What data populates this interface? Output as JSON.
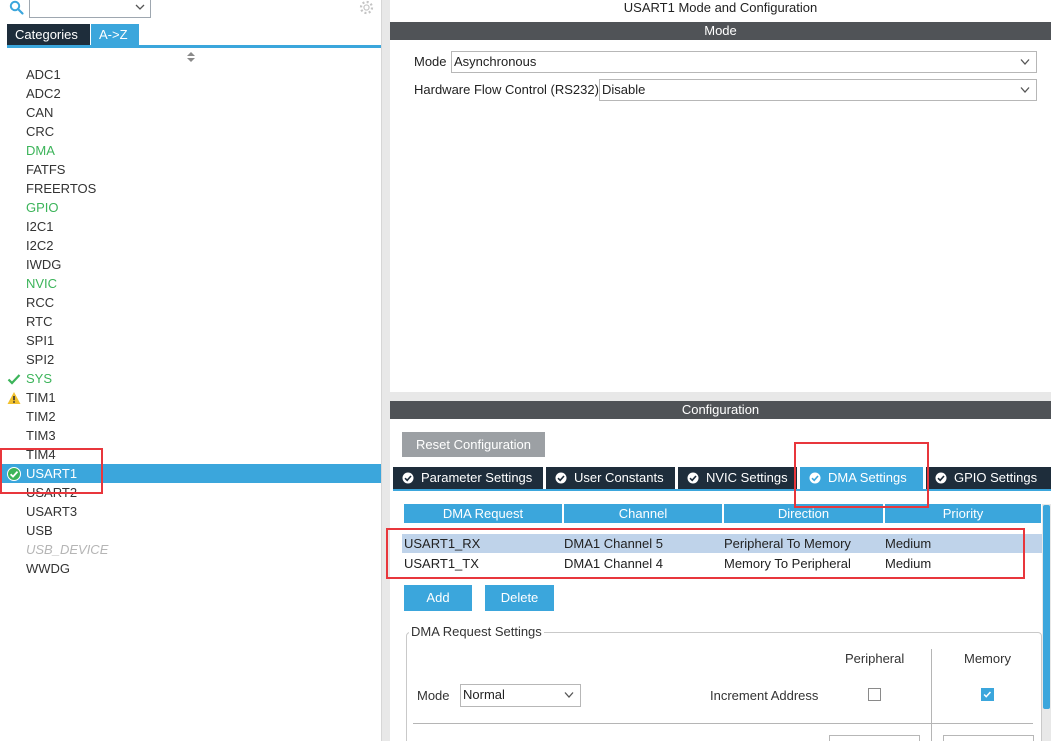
{
  "left_panel": {
    "search_value": "",
    "tabs": [
      "Categories",
      "A->Z"
    ],
    "peripherals": [
      {
        "label": "ADC1",
        "state": "normal"
      },
      {
        "label": "ADC2",
        "state": "normal"
      },
      {
        "label": "CAN",
        "state": "normal"
      },
      {
        "label": "CRC",
        "state": "normal"
      },
      {
        "label": "DMA",
        "state": "green"
      },
      {
        "label": "FATFS",
        "state": "normal"
      },
      {
        "label": "FREERTOS",
        "state": "normal"
      },
      {
        "label": "GPIO",
        "state": "green"
      },
      {
        "label": "I2C1",
        "state": "normal"
      },
      {
        "label": "I2C2",
        "state": "normal"
      },
      {
        "label": "IWDG",
        "state": "normal"
      },
      {
        "label": "NVIC",
        "state": "green"
      },
      {
        "label": "RCC",
        "state": "normal"
      },
      {
        "label": "RTC",
        "state": "normal"
      },
      {
        "label": "SPI1",
        "state": "normal"
      },
      {
        "label": "SPI2",
        "state": "normal"
      },
      {
        "label": "SYS",
        "state": "green-check"
      },
      {
        "label": "TIM1",
        "state": "warning"
      },
      {
        "label": "TIM2",
        "state": "normal"
      },
      {
        "label": "TIM3",
        "state": "normal"
      },
      {
        "label": "TIM4",
        "state": "normal"
      },
      {
        "label": "USART1",
        "state": "selected-check"
      },
      {
        "label": "USART2",
        "state": "normal"
      },
      {
        "label": "USART3",
        "state": "normal"
      },
      {
        "label": "USB",
        "state": "normal"
      },
      {
        "label": "USB_DEVICE",
        "state": "disabled"
      },
      {
        "label": "WWDG",
        "state": "normal"
      }
    ]
  },
  "right_panel": {
    "title": "USART1 Mode and Configuration",
    "mode_section": "Mode",
    "mode_label": "Mode",
    "mode_value": "Asynchronous",
    "hwflow_label": "Hardware Flow Control (RS232)",
    "hwflow_value": "Disable",
    "config_section": "Configuration",
    "reset_button": "Reset Configuration",
    "config_tabs": [
      "Parameter Settings",
      "User Constants",
      "NVIC Settings",
      "DMA Settings",
      "GPIO Settings"
    ],
    "table_headers": [
      "DMA Request",
      "Channel",
      "Direction",
      "Priority"
    ],
    "table_rows": [
      [
        "USART1_RX",
        "DMA1 Channel 5",
        "Peripheral To Memory",
        "Medium"
      ],
      [
        "USART1_TX",
        "DMA1 Channel 4",
        "Memory To Peripheral",
        "Medium"
      ]
    ],
    "add_button": "Add",
    "delete_button": "Delete",
    "dma_group_title": "DMA Request Settings",
    "peripheral_col": "Peripheral",
    "memory_col": "Memory",
    "dma_mode_label": "Mode",
    "dma_mode_value": "Normal",
    "increment_label": "Increment Address",
    "increment_peripheral": false,
    "increment_memory": true
  },
  "colors": {
    "accent": "#3ba6dc",
    "dark_tab": "#1e2d3b",
    "section_bar": "#505357",
    "ok_green": "#3cb45a",
    "highlight_red": "#e8363c"
  }
}
